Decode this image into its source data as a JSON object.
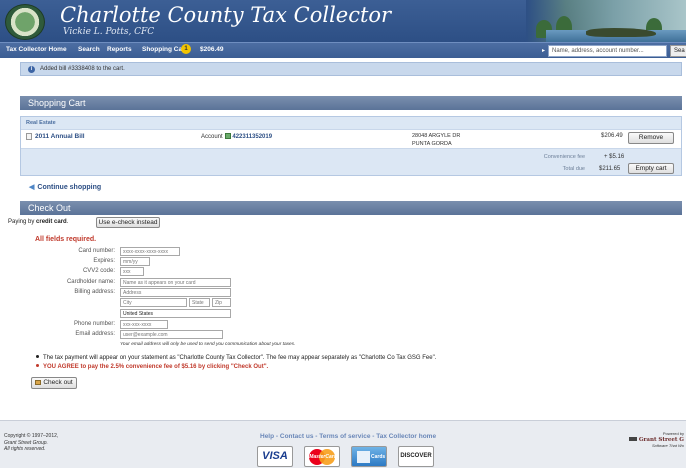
{
  "header": {
    "title": "Charlotte County Tax Collector",
    "subtitle": "Vickie L. Potts, CFC"
  },
  "nav": {
    "items": [
      "Tax Collector Home",
      "Search",
      "Reports",
      "Shopping Cart",
      "$206.49"
    ],
    "cart_count": "1",
    "search_placeholder": "Name, address, account number...",
    "search_button": "Sea"
  },
  "info": {
    "message": "Added bill #3338408 to the cart."
  },
  "cart": {
    "heading": "Shopping Cart",
    "category": "Real Estate",
    "bill_label": "2011 Annual Bill",
    "account_label": "Account",
    "account_number": "422311352019",
    "address_line1": "28048 ARGYLE DR",
    "address_line2": "PUNTA GORDA",
    "amount": "$206.49",
    "remove_label": "Remove",
    "fee_label": "Convenience fee",
    "fee_value": "+ $5.16",
    "total_label": "Total due",
    "total_value": "$211.65",
    "empty_label": "Empty cart",
    "continue_label": "Continue shopping"
  },
  "checkout": {
    "heading": "Check Out",
    "paying_prefix": "Paying by",
    "paying_method": "credit card",
    "echeck_button": "Use e-check instead",
    "required": "All fields required.",
    "fields": {
      "card_number": {
        "label": "Card number:",
        "placeholder": "xxxx-xxxx-xxxx-xxxx"
      },
      "expires": {
        "label": "Expires:",
        "placeholder": "mm/yy"
      },
      "cvv2": {
        "label": "CVV2 code:",
        "placeholder": "xxx"
      },
      "cardholder": {
        "label": "Cardholder name:",
        "placeholder": "Name as it appears on your card"
      },
      "billing": {
        "label": "Billing address:",
        "address_placeholder": "Address",
        "city_placeholder": "City",
        "state_placeholder": "State",
        "zip_placeholder": "Zip",
        "country": "United States"
      },
      "phone": {
        "label": "Phone number:",
        "placeholder": "xxx-xxx-xxxx"
      },
      "email": {
        "label": "Email address:",
        "placeholder": "user@example.com"
      }
    },
    "email_note": "Your email address will only be used to send you communication about your taxes.",
    "notice_1": "The tax payment will appear on your statement as \"Charlotte County Tax Collector\". The fee may appear separately as \"Charlotte Co Tax GSG Fee\".",
    "notice_2": "YOU AGREE to pay the 2.5% convenience fee of $5.16 by clicking \"Check Out\".",
    "checkout_button": "Check out"
  },
  "footer": {
    "copyright": "Copyright © 1997–2012,",
    "company": "Grant Street Group.",
    "rights": "All rights reserved.",
    "links": [
      "Help",
      "Contact us",
      "Terms of service",
      "Tax Collector home"
    ],
    "link_separator": " - ",
    "cards": [
      "VISA",
      "MasterCard",
      "Cards",
      "DISCOVER"
    ],
    "powered_by": "Powered by",
    "powered_company": "Grant Street G",
    "powered_tagline": "Software That Wo"
  }
}
